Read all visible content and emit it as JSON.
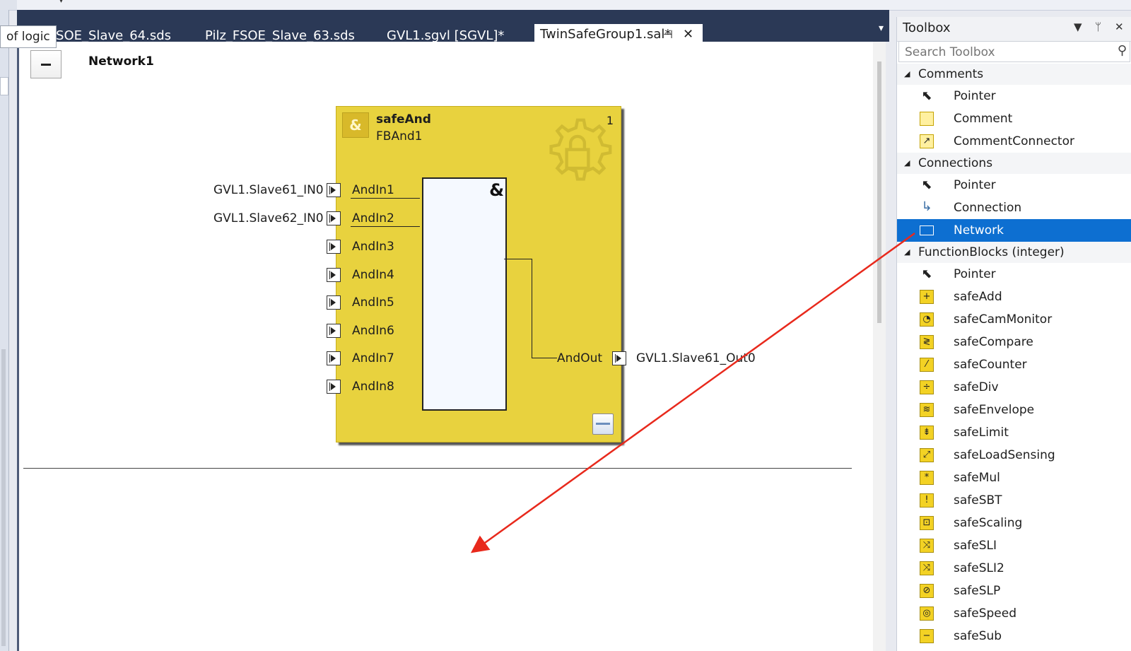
{
  "tooltip": "of logic",
  "tabs": [
    {
      "label": "FSOE_Slave_64.sds"
    },
    {
      "label": "Pilz_FSOE_Slave_63.sds"
    },
    {
      "label": "GVL1.sgvl [SGVL]*"
    },
    {
      "label": "TwinSafeGroup1.sal*",
      "pin": "⊣",
      "close": "✕"
    }
  ],
  "tab_overflow": "▾",
  "network": {
    "title": "Network1"
  },
  "function_block": {
    "type": "safeAnd",
    "name": "FBAnd1",
    "number": "1",
    "operator_symbol": "&",
    "icon_text": "&",
    "inputs": [
      "AndIn1",
      "AndIn2",
      "AndIn3",
      "AndIn4",
      "AndIn5",
      "AndIn6",
      "AndIn7",
      "AndIn8"
    ],
    "output": "AndOut"
  },
  "variables": {
    "in1": "GVL1.Slave61_IN0",
    "in2": "GVL1.Slave62_IN0",
    "out": "GVL1.Slave61_Out0"
  },
  "toolbox": {
    "title": "Toolbox",
    "search_placeholder": "Search Toolbox",
    "dropdown_icon": "▼",
    "pin_icon": "ᛘ",
    "close_icon": "✕",
    "search_icon": "⚲",
    "categories": [
      {
        "label": "Comments",
        "items": [
          "Pointer",
          "Comment",
          "CommentConnector"
        ]
      },
      {
        "label": "Connections",
        "items": [
          "Pointer",
          "Connection",
          "Network"
        ]
      },
      {
        "label": "FunctionBlocks (integer)",
        "items": [
          "Pointer",
          "safeAdd",
          "safeCamMonitor",
          "safeCompare",
          "safeCounter",
          "safeDiv",
          "safeEnvelope",
          "safeLimit",
          "safeLoadSensing",
          "safeMul",
          "safeSBT",
          "safeScaling",
          "safeSLI",
          "safeSLI2",
          "safeSLP",
          "safeSpeed",
          "safeSub"
        ]
      }
    ],
    "selected_item": "Network",
    "icons": {
      "pointer": "⬉",
      "safeAdd": "+",
      "safeCamMonitor": "◔",
      "safeCompare": "≷",
      "safeCounter": "⁄",
      "safeDiv": "÷",
      "safeEnvelope": "≋",
      "safeLimit": "⇟",
      "safeLoadSensing": "⤢",
      "safeMul": "*",
      "safeSBT": "!",
      "safeScaling": "⊡",
      "safeSLI": "⤨",
      "safeSLI2": "⤨",
      "safeSLP": "⊘",
      "safeSpeed": "◎",
      "safeSub": "−"
    }
  },
  "annotation_color": "#e8291c"
}
